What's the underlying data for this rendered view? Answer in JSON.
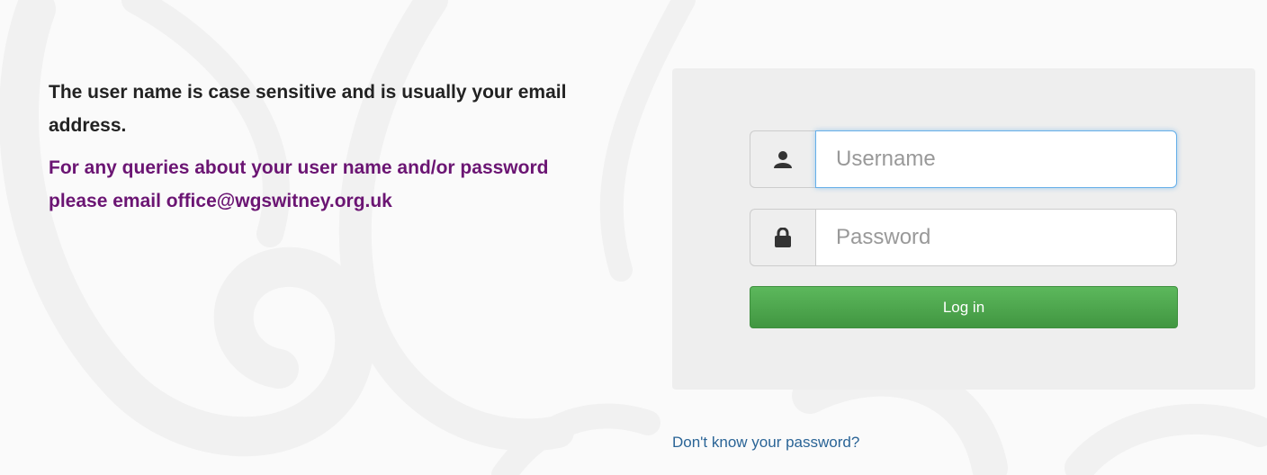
{
  "info": {
    "note": "The user name is case sensitive and is usually your email address.",
    "contact": "For any queries about your user name and/or password please email office@wgswitney.org.uk"
  },
  "login": {
    "username_placeholder": "Username",
    "username_value": "",
    "password_placeholder": "Password",
    "password_value": "",
    "submit_label": "Log in",
    "user_icon": "user-icon",
    "lock_icon": "lock-icon"
  },
  "links": {
    "forgot_password": "Don't know your password?"
  },
  "colors": {
    "background": "#fafafa",
    "panel": "#eeeeee",
    "contact_text": "#6b1573",
    "button_green": "#5cb85c",
    "link": "#2a6496",
    "focus_border": "#66afe9"
  }
}
